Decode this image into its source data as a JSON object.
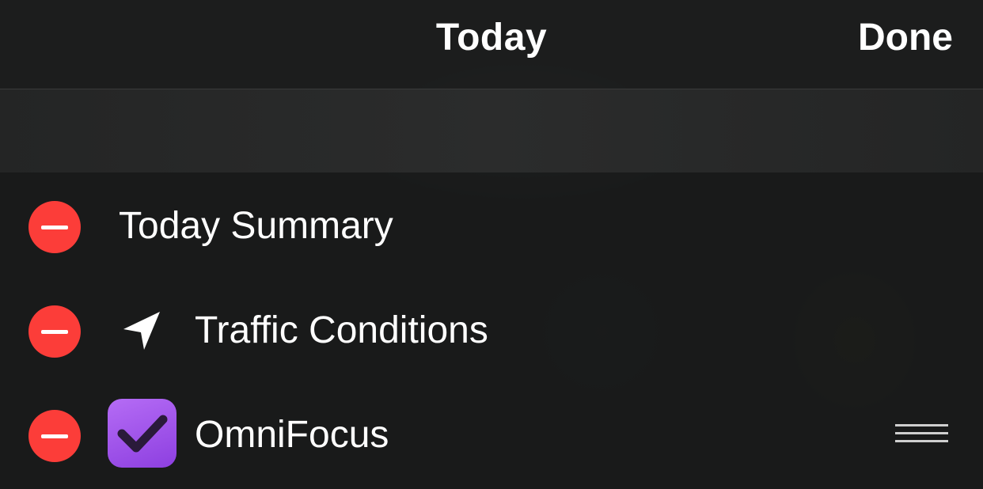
{
  "navbar": {
    "title": "Today",
    "done_label": "Done"
  },
  "widgets": [
    {
      "label": "Today Summary",
      "icon": null
    },
    {
      "label": "Traffic Conditions",
      "icon": "location-arrow-icon"
    },
    {
      "label": "OmniFocus",
      "icon": "omnifocus-app-icon"
    }
  ],
  "colors": {
    "delete_red": "#fc3d39",
    "omnifocus_purple": "#9b4fe8",
    "background": "#1a1b1b"
  }
}
